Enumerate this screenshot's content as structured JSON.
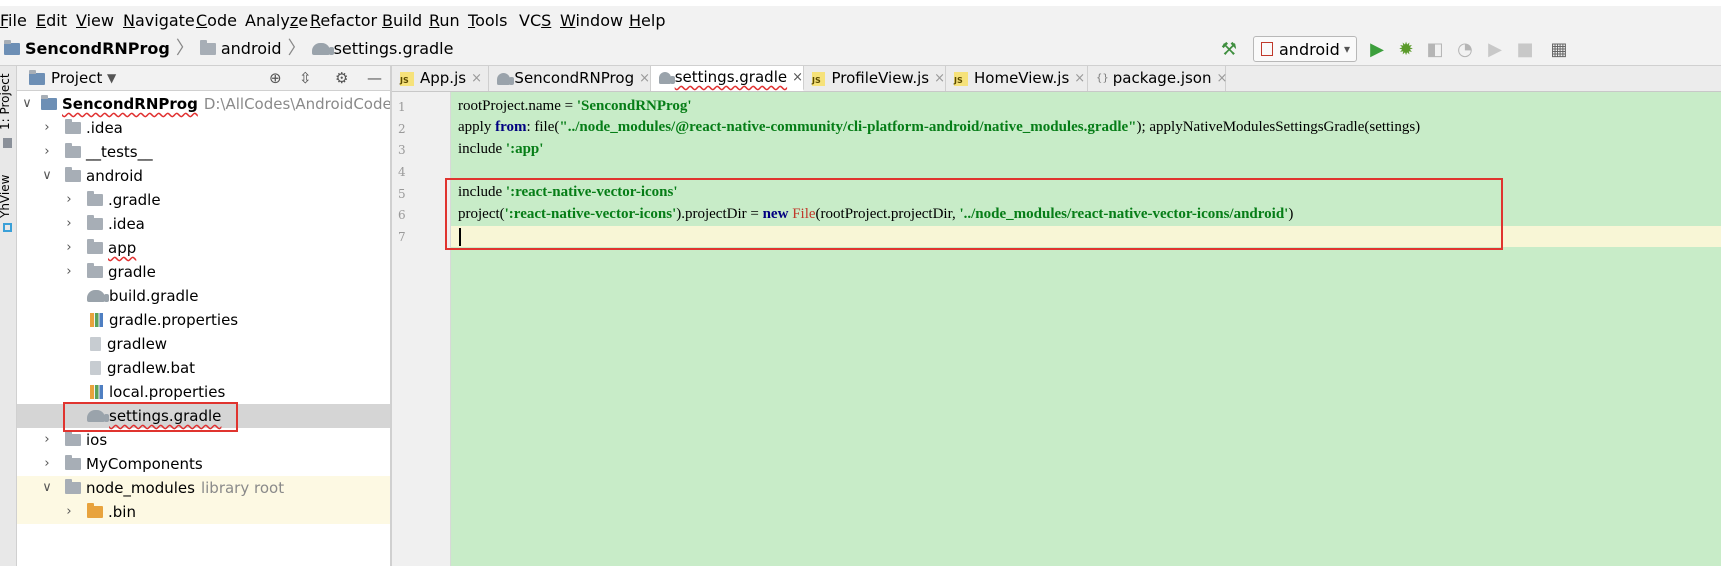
{
  "menu": [
    "File",
    "Edit",
    "View",
    "Navigate",
    "Code",
    "Analyze",
    "Refactor",
    "Build",
    "Run",
    "Tools",
    "VCS",
    "Window",
    "Help"
  ],
  "menu_mnemonic": [
    "F",
    "E",
    "V",
    "N",
    "C",
    "z",
    "R",
    "B",
    "R",
    "T",
    "S",
    "W",
    "H"
  ],
  "breadcrumb": {
    "project": "SencondRNProg",
    "folder": "android",
    "file": "settings.gradle"
  },
  "run_config": {
    "label": "android"
  },
  "left_tool_tabs": {
    "project": "1: Project",
    "yhview": "YhView"
  },
  "project_panel": {
    "title": "Project"
  },
  "tree": {
    "root_name": "SencondRNProg",
    "root_path": "D:\\AllCodes\\AndroidCode\\reac",
    "items": {
      "idea": ".idea",
      "tests": "__tests__",
      "android": "android",
      "gradle_dir": ".gradle",
      "android_idea": ".idea",
      "app": "app",
      "gradle": "gradle",
      "build_gradle": "build.gradle",
      "gradle_properties": "gradle.properties",
      "gradlew": "gradlew",
      "gradlew_bat": "gradlew.bat",
      "local_properties": "local.properties",
      "settings_gradle": "settings.gradle",
      "ios": "ios",
      "mycomponents": "MyComponents",
      "node_modules": "node_modules",
      "node_modules_note": "library root",
      "bin": ".bin"
    }
  },
  "tabs": [
    "App.js",
    "SencondRNProg",
    "settings.gradle",
    "ProfileView.js",
    "HomeView.js",
    "package.json"
  ],
  "active_tab": "settings.gradle",
  "js_badge": "JS",
  "json_badge": "{}",
  "close_glyph": "×",
  "line_numbers": [
    "1",
    "2",
    "3",
    "4",
    "5",
    "6",
    "7"
  ],
  "code": {
    "l1": {
      "a": "rootProject.name = ",
      "b": "'SencondRNProg'"
    },
    "l2": {
      "a": "apply ",
      "b": "from",
      "c": ": file(",
      "d": "\"../node_modules/@react-native-community/cli-platform-android/native_modules.gradle\"",
      "e": "); applyNativeModulesSettingsGradle(settings)"
    },
    "l3": {
      "a": "include ",
      "b": "':app'"
    },
    "l5": {
      "a": "include ",
      "b": "':react-native-vector-icons'"
    },
    "l6": {
      "a": "project(",
      "b": "':react-native-vector-icons'",
      "c": ").projectDir = ",
      "d": "new",
      "e": " ",
      "f": "File",
      "g": "(rootProject.projectDir, ",
      "h": "'../node_modules/react-native-vector-icons/android'",
      "i": ")"
    }
  },
  "colors": {
    "highlight_box": "#e0342f",
    "editor_bg": "#c8ecc8",
    "string": "#067d17",
    "keyword": "#000080"
  }
}
